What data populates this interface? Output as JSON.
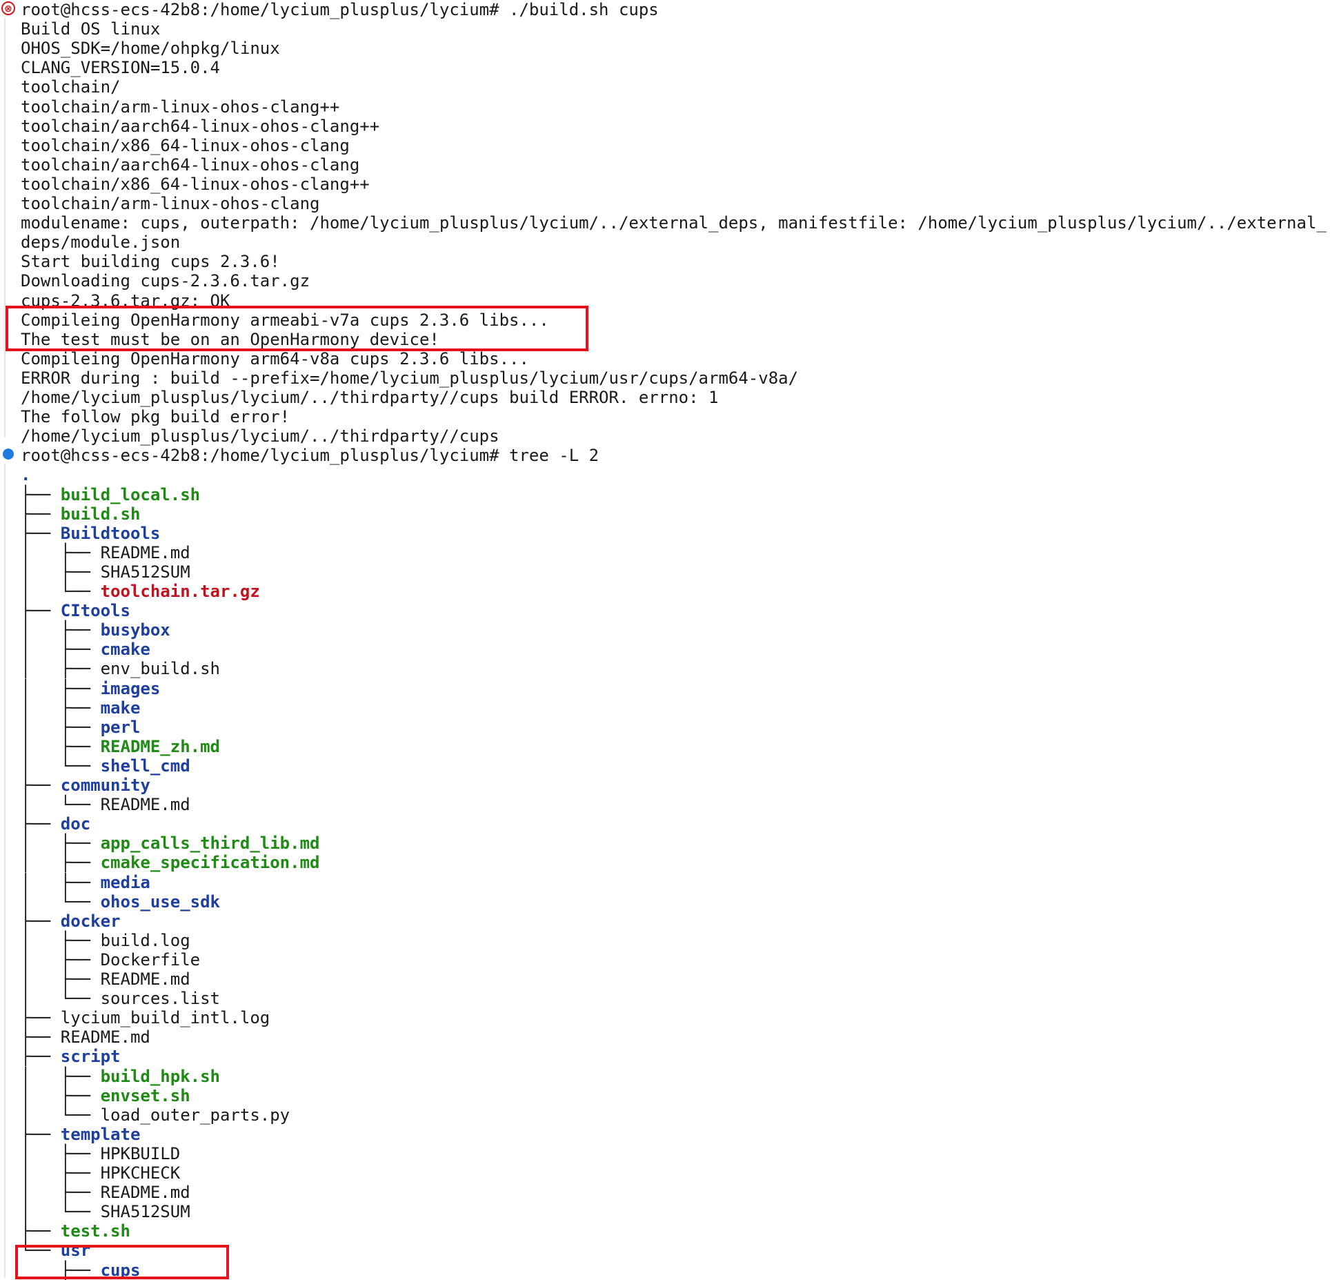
{
  "terminal": {
    "lines": [
      {
        "segs": [
          {
            "t": "root@hcss-ecs-42b8:/home/lycium_plusplus/lycium# ./build.sh cups",
            "c": ""
          }
        ]
      },
      {
        "segs": [
          {
            "t": "Build OS linux",
            "c": ""
          }
        ]
      },
      {
        "segs": [
          {
            "t": "OHOS_SDK=/home/ohpkg/linux",
            "c": ""
          }
        ]
      },
      {
        "segs": [
          {
            "t": "CLANG_VERSION=15.0.4",
            "c": ""
          }
        ]
      },
      {
        "segs": [
          {
            "t": "toolchain/",
            "c": ""
          }
        ]
      },
      {
        "segs": [
          {
            "t": "toolchain/arm-linux-ohos-clang++",
            "c": ""
          }
        ]
      },
      {
        "segs": [
          {
            "t": "toolchain/aarch64-linux-ohos-clang++",
            "c": ""
          }
        ]
      },
      {
        "segs": [
          {
            "t": "toolchain/x86_64-linux-ohos-clang",
            "c": ""
          }
        ]
      },
      {
        "segs": [
          {
            "t": "toolchain/aarch64-linux-ohos-clang",
            "c": ""
          }
        ]
      },
      {
        "segs": [
          {
            "t": "toolchain/x86_64-linux-ohos-clang++",
            "c": ""
          }
        ]
      },
      {
        "segs": [
          {
            "t": "toolchain/arm-linux-ohos-clang",
            "c": ""
          }
        ]
      },
      {
        "segs": [
          {
            "t": "modulename: cups, outerpath: /home/lycium_plusplus/lycium/../external_deps, manifestfile: /home/lycium_plusplus/lycium/../external_",
            "c": ""
          }
        ]
      },
      {
        "segs": [
          {
            "t": "deps/module.json",
            "c": ""
          }
        ]
      },
      {
        "segs": [
          {
            "t": "Start building cups 2.3.6!",
            "c": ""
          }
        ]
      },
      {
        "segs": [
          {
            "t": "Downloading cups-2.3.6.tar.gz",
            "c": ""
          }
        ]
      },
      {
        "segs": [
          {
            "t": "cups-2.3.6.tar.gz: OK",
            "c": ""
          }
        ]
      },
      {
        "segs": [
          {
            "t": "Compileing OpenHarmony armeabi-v7a cups 2.3.6 libs...",
            "c": ""
          }
        ]
      },
      {
        "segs": [
          {
            "t": "The test must be on an OpenHarmony device!",
            "c": ""
          }
        ]
      },
      {
        "segs": [
          {
            "t": "Compileing OpenHarmony arm64-v8a cups 2.3.6 libs...",
            "c": ""
          }
        ]
      },
      {
        "segs": [
          {
            "t": "ERROR during : build --prefix=/home/lycium_plusplus/lycium/usr/cups/arm64-v8a/",
            "c": ""
          }
        ]
      },
      {
        "segs": [
          {
            "t": "/home/lycium_plusplus/lycium/../thirdparty//cups build ERROR. errno: 1",
            "c": ""
          }
        ]
      },
      {
        "segs": [
          {
            "t": "The follow pkg build error!",
            "c": ""
          }
        ]
      },
      {
        "segs": [
          {
            "t": "/home/lycium_plusplus/lycium/../thirdparty//cups",
            "c": ""
          }
        ]
      },
      {
        "segs": [
          {
            "t": "root@hcss-ecs-42b8:/home/lycium_plusplus/lycium# tree -L 2",
            "c": ""
          }
        ]
      },
      {
        "segs": [
          {
            "t": ".",
            "c": "dir"
          }
        ]
      },
      {
        "segs": [
          {
            "t": "├── ",
            "c": "prefix"
          },
          {
            "t": "build_local.sh",
            "c": "exec"
          }
        ]
      },
      {
        "segs": [
          {
            "t": "├── ",
            "c": "prefix"
          },
          {
            "t": "build.sh",
            "c": "exec"
          }
        ]
      },
      {
        "segs": [
          {
            "t": "├── ",
            "c": "prefix"
          },
          {
            "t": "Buildtools",
            "c": "dir"
          }
        ]
      },
      {
        "segs": [
          {
            "t": "│   ├── ",
            "c": "prefix"
          },
          {
            "t": "README.md",
            "c": ""
          }
        ]
      },
      {
        "segs": [
          {
            "t": "│   ├── ",
            "c": "prefix"
          },
          {
            "t": "SHA512SUM",
            "c": ""
          }
        ]
      },
      {
        "segs": [
          {
            "t": "│   └── ",
            "c": "prefix"
          },
          {
            "t": "toolchain.tar.gz",
            "c": "arch"
          }
        ]
      },
      {
        "segs": [
          {
            "t": "├── ",
            "c": "prefix"
          },
          {
            "t": "CItools",
            "c": "dir"
          }
        ]
      },
      {
        "segs": [
          {
            "t": "│   ├── ",
            "c": "prefix"
          },
          {
            "t": "busybox",
            "c": "dir"
          }
        ]
      },
      {
        "segs": [
          {
            "t": "│   ├── ",
            "c": "prefix"
          },
          {
            "t": "cmake",
            "c": "dir"
          }
        ]
      },
      {
        "segs": [
          {
            "t": "│   ├── ",
            "c": "prefix"
          },
          {
            "t": "env_build.sh",
            "c": ""
          }
        ]
      },
      {
        "segs": [
          {
            "t": "│   ├── ",
            "c": "prefix"
          },
          {
            "t": "images",
            "c": "dir"
          }
        ]
      },
      {
        "segs": [
          {
            "t": "│   ├── ",
            "c": "prefix"
          },
          {
            "t": "make",
            "c": "dir"
          }
        ]
      },
      {
        "segs": [
          {
            "t": "│   ├── ",
            "c": "prefix"
          },
          {
            "t": "perl",
            "c": "dir"
          }
        ]
      },
      {
        "segs": [
          {
            "t": "│   ├── ",
            "c": "prefix"
          },
          {
            "t": "README_zh.md",
            "c": "exec"
          }
        ]
      },
      {
        "segs": [
          {
            "t": "│   └── ",
            "c": "prefix"
          },
          {
            "t": "shell_cmd",
            "c": "dir"
          }
        ]
      },
      {
        "segs": [
          {
            "t": "├── ",
            "c": "prefix"
          },
          {
            "t": "community",
            "c": "dir"
          }
        ]
      },
      {
        "segs": [
          {
            "t": "│   └── ",
            "c": "prefix"
          },
          {
            "t": "README.md",
            "c": ""
          }
        ]
      },
      {
        "segs": [
          {
            "t": "├── ",
            "c": "prefix"
          },
          {
            "t": "doc",
            "c": "dir"
          }
        ]
      },
      {
        "segs": [
          {
            "t": "│   ├── ",
            "c": "prefix"
          },
          {
            "t": "app_calls_third_lib.md",
            "c": "exec"
          }
        ]
      },
      {
        "segs": [
          {
            "t": "│   ├── ",
            "c": "prefix"
          },
          {
            "t": "cmake_specification.md",
            "c": "exec"
          }
        ]
      },
      {
        "segs": [
          {
            "t": "│   ├── ",
            "c": "prefix"
          },
          {
            "t": "media",
            "c": "dir"
          }
        ]
      },
      {
        "segs": [
          {
            "t": "│   └── ",
            "c": "prefix"
          },
          {
            "t": "ohos_use_sdk",
            "c": "dir"
          }
        ]
      },
      {
        "segs": [
          {
            "t": "├── ",
            "c": "prefix"
          },
          {
            "t": "docker",
            "c": "dir"
          }
        ]
      },
      {
        "segs": [
          {
            "t": "│   ├── ",
            "c": "prefix"
          },
          {
            "t": "build.log",
            "c": ""
          }
        ]
      },
      {
        "segs": [
          {
            "t": "│   ├── ",
            "c": "prefix"
          },
          {
            "t": "Dockerfile",
            "c": ""
          }
        ]
      },
      {
        "segs": [
          {
            "t": "│   ├── ",
            "c": "prefix"
          },
          {
            "t": "README.md",
            "c": ""
          }
        ]
      },
      {
        "segs": [
          {
            "t": "│   └── ",
            "c": "prefix"
          },
          {
            "t": "sources.list",
            "c": ""
          }
        ]
      },
      {
        "segs": [
          {
            "t": "├── ",
            "c": "prefix"
          },
          {
            "t": "lycium_build_intl.log",
            "c": ""
          }
        ]
      },
      {
        "segs": [
          {
            "t": "├── ",
            "c": "prefix"
          },
          {
            "t": "README.md",
            "c": ""
          }
        ]
      },
      {
        "segs": [
          {
            "t": "├── ",
            "c": "prefix"
          },
          {
            "t": "script",
            "c": "dir"
          }
        ]
      },
      {
        "segs": [
          {
            "t": "│   ├── ",
            "c": "prefix"
          },
          {
            "t": "build_hpk.sh",
            "c": "exec"
          }
        ]
      },
      {
        "segs": [
          {
            "t": "│   ├── ",
            "c": "prefix"
          },
          {
            "t": "envset.sh",
            "c": "exec"
          }
        ]
      },
      {
        "segs": [
          {
            "t": "│   └── ",
            "c": "prefix"
          },
          {
            "t": "load_outer_parts.py",
            "c": ""
          }
        ]
      },
      {
        "segs": [
          {
            "t": "├── ",
            "c": "prefix"
          },
          {
            "t": "template",
            "c": "dir"
          }
        ]
      },
      {
        "segs": [
          {
            "t": "│   ├── ",
            "c": "prefix"
          },
          {
            "t": "HPKBUILD",
            "c": ""
          }
        ]
      },
      {
        "segs": [
          {
            "t": "│   ├── ",
            "c": "prefix"
          },
          {
            "t": "HPKCHECK",
            "c": ""
          }
        ]
      },
      {
        "segs": [
          {
            "t": "│   ├── ",
            "c": "prefix"
          },
          {
            "t": "README.md",
            "c": ""
          }
        ]
      },
      {
        "segs": [
          {
            "t": "│   └── ",
            "c": "prefix"
          },
          {
            "t": "SHA512SUM",
            "c": ""
          }
        ]
      },
      {
        "segs": [
          {
            "t": "├── ",
            "c": "prefix"
          },
          {
            "t": "test.sh",
            "c": "exec"
          }
        ]
      },
      {
        "segs": [
          {
            "t": "└── ",
            "c": "prefix"
          },
          {
            "t": "usr",
            "c": "dir"
          }
        ]
      },
      {
        "segs": [
          {
            "t": "    ├── ",
            "c": "prefix"
          },
          {
            "t": "cups",
            "c": "dir"
          }
        ]
      }
    ]
  },
  "gutter": {
    "error_marker": "⊗",
    "error_color": "#d01818",
    "success_color": "#1f7ae0"
  },
  "colors": {
    "directory": "#1f3f9e",
    "executable": "#1f8a14",
    "archive": "#c1121f",
    "highlight_box": "#e5141b"
  }
}
